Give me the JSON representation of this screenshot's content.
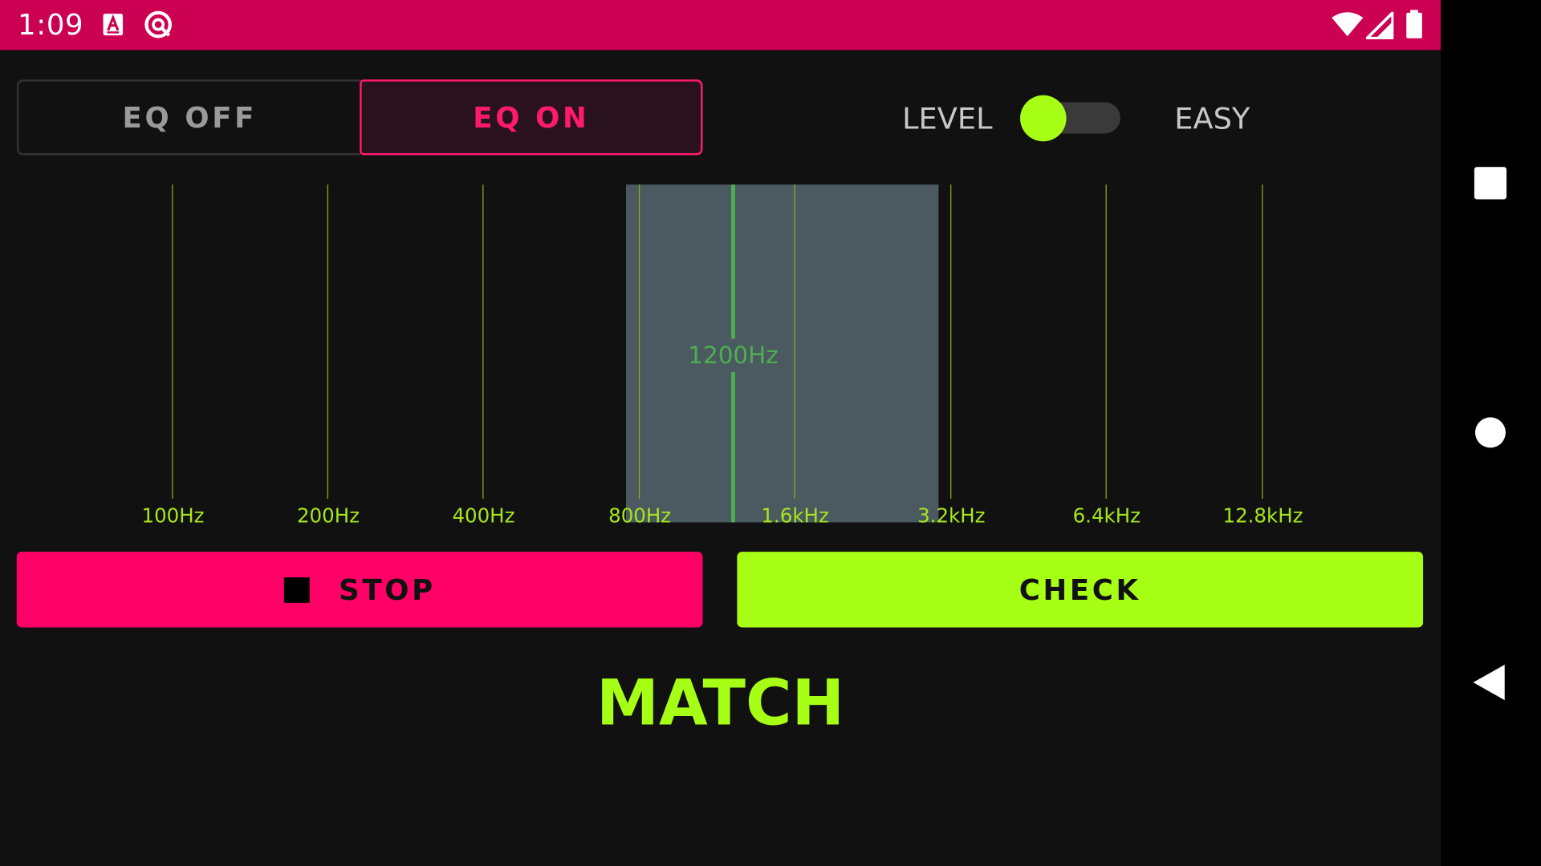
{
  "status_bar": {
    "time": "1:09",
    "icons": [
      "a-notification-icon",
      "sync-notification-icon",
      "wifi-icon",
      "signal-icon",
      "battery-icon"
    ],
    "background_color": "#cc0052"
  },
  "eq_toggle": {
    "off_label": "EQ OFF",
    "on_label": "EQ ON",
    "selected": "EQ ON"
  },
  "difficulty": {
    "level_label": "LEVEL",
    "easy_label": "EASY",
    "switch_on": false
  },
  "bands": [
    {
      "label": "100Hz"
    },
    {
      "label": "200Hz"
    },
    {
      "label": "400Hz"
    },
    {
      "label": "800Hz"
    },
    {
      "label": "1.6kHz"
    },
    {
      "label": "3.2kHz"
    },
    {
      "label": "6.4kHz"
    },
    {
      "label": "12.8kHz"
    }
  ],
  "selection": {
    "label": "1200Hz"
  },
  "buttons": {
    "stop_label": "STOP",
    "check_label": "CHECK"
  },
  "result": "MATCH",
  "colors": {
    "accent_pink": "#ff0066",
    "accent_lime": "#a6ff14",
    "selection_green": "#4caf50",
    "background": "#111111"
  },
  "nav_bar": {
    "icons": [
      "recents-icon",
      "home-icon",
      "back-icon"
    ]
  }
}
